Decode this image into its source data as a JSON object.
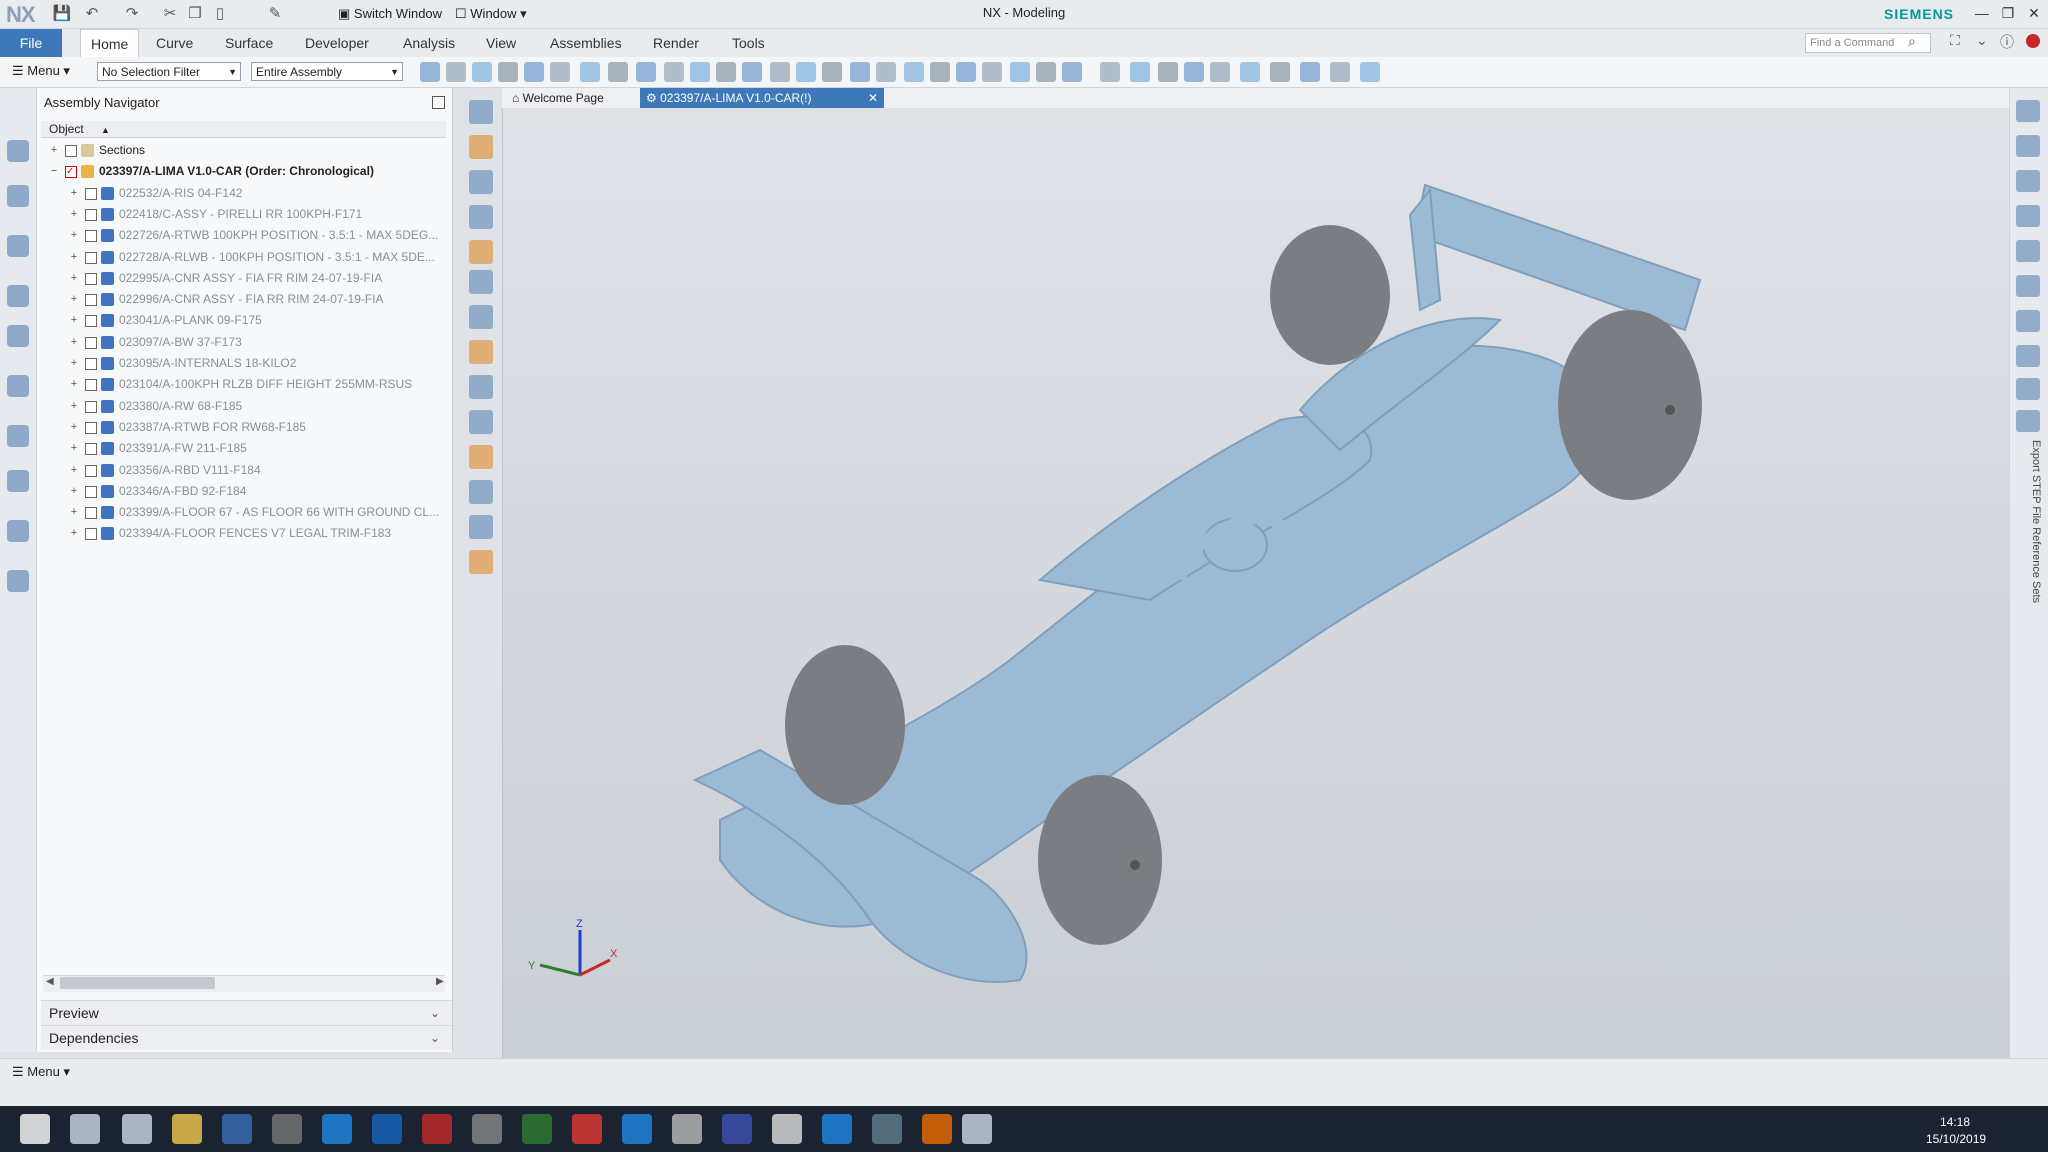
{
  "titlebar": {
    "logo": "NX",
    "switch_window": "Switch Window",
    "window_menu": "Window",
    "app_title": "NX - Modeling",
    "brand": "SIEMENS"
  },
  "ribbon": {
    "tabs": [
      "File",
      "Home",
      "Curve",
      "Surface",
      "Developer",
      "Analysis",
      "View",
      "Assemblies",
      "Render",
      "Tools"
    ],
    "find_placeholder": "Find a Command"
  },
  "toolbar": {
    "menu_label": "Menu",
    "selection_filter": "No Selection Filter",
    "scope": "Entire Assembly"
  },
  "navigator": {
    "title": "Assembly Navigator",
    "column_object": "Object",
    "rows": [
      {
        "label": "Sections",
        "level": 0
      },
      {
        "label": "023397/A-LIMA V1.0-CAR (Order: Chronological)",
        "level": 0
      },
      {
        "label": "022532/A-RIS 04-F142",
        "level": 1
      },
      {
        "label": "022418/C-ASSY - PIRELLI RR 100KPH-F171",
        "level": 1
      },
      {
        "label": "022726/A-RTWB 100KPH POSITION - 3.5:1 - MAX 5DEG...",
        "level": 1
      },
      {
        "label": "022728/A-RLWB - 100KPH POSITION - 3.5:1 - MAX 5DE...",
        "level": 1
      },
      {
        "label": "022995/A-CNR ASSY - FIA FR RIM 24-07-19-FIA",
        "level": 1
      },
      {
        "label": "022996/A-CNR ASSY - FIA RR RIM 24-07-19-FIA",
        "level": 1
      },
      {
        "label": "023041/A-PLANK 09-F175",
        "level": 1
      },
      {
        "label": "023097/A-BW 37-F173",
        "level": 1
      },
      {
        "label": "023095/A-INTERNALS 18-KILO2",
        "level": 1
      },
      {
        "label": "023104/A-100KPH RLZB DIFF HEIGHT 255MM-RSUS",
        "level": 1
      },
      {
        "label": "023380/A-RW 68-F185",
        "level": 1
      },
      {
        "label": "023387/A-RTWB FOR RW68-F185",
        "level": 1
      },
      {
        "label": "023391/A-FW 211-F185",
        "level": 1
      },
      {
        "label": "023356/A-RBD V111-F184",
        "level": 1
      },
      {
        "label": "023346/A-FBD 92-F184",
        "level": 1
      },
      {
        "label": "023399/A-FLOOR 67 - AS FLOOR 66 WITH GROUND CL...",
        "level": 1
      },
      {
        "label": "023394/A-FLOOR FENCES V7 LEGAL TRIM-F183",
        "level": 1
      }
    ],
    "preview": "Preview",
    "dependencies": "Dependencies"
  },
  "graphics": {
    "welcome_tab": "Welcome Page",
    "part_tab": "023397/A-LIMA V1.0-CAR(!)",
    "triad": {
      "z": "Z",
      "y": "Y",
      "x": "X"
    },
    "model_color": "#9dbad4",
    "tyre_color": "#7a7d82"
  },
  "rightbar": {
    "vertical_label": "Export STEP File   Reference Sets"
  },
  "status": {
    "menu_label": "Menu"
  },
  "taskbar": {
    "time": "14:18",
    "date": "15/10/2019"
  }
}
